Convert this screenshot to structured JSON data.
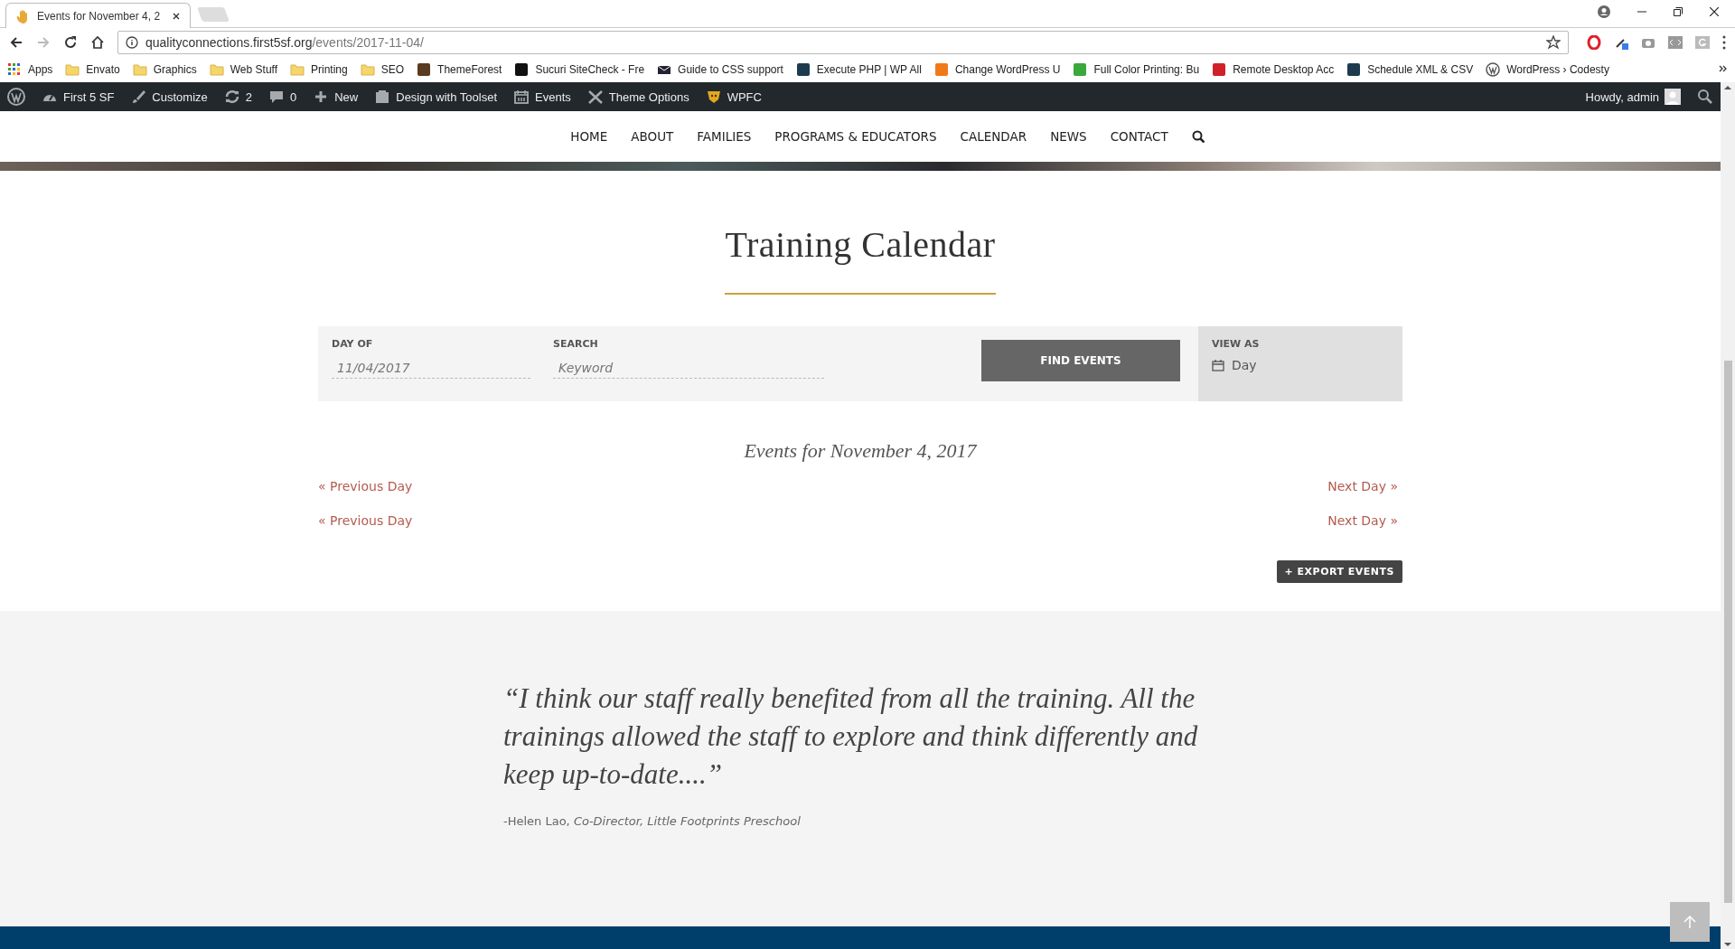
{
  "browser": {
    "tab": {
      "title": "Events for November 4, 2"
    },
    "address": {
      "host": "qualityconnections.first5sf.org",
      "path": "/events/2017-11-04/"
    },
    "bookmarks": [
      {
        "label": "Apps",
        "kind": "apps"
      },
      {
        "label": "Envato",
        "kind": "folder"
      },
      {
        "label": "Graphics",
        "kind": "folder"
      },
      {
        "label": "Web Stuff",
        "kind": "folder"
      },
      {
        "label": "Printing",
        "kind": "folder"
      },
      {
        "label": "SEO",
        "kind": "folder"
      },
      {
        "label": "ThemeForest",
        "kind": "site",
        "color": "#5a3b1e"
      },
      {
        "label": "Sucuri SiteCheck - Fre",
        "kind": "site",
        "color": "#111111"
      },
      {
        "label": "Guide to CSS support",
        "kind": "mail"
      },
      {
        "label": "Execute PHP | WP All",
        "kind": "site",
        "color": "#1d3b4f"
      },
      {
        "label": "Change WordPress U",
        "kind": "site",
        "color": "#f07a18"
      },
      {
        "label": "Full Color Printing: Bu",
        "kind": "site",
        "color": "#3aa83a"
      },
      {
        "label": "Remote Desktop Acc",
        "kind": "site",
        "color": "#d0202a"
      },
      {
        "label": "Schedule XML & CSV",
        "kind": "site",
        "color": "#1d3b4f"
      },
      {
        "label": "WordPress › Codesty",
        "kind": "wp"
      }
    ]
  },
  "admin_bar": {
    "items": [
      {
        "label": "First 5 SF",
        "kind": "dashboard"
      },
      {
        "label": "Customize",
        "kind": "brush"
      },
      {
        "label": "2",
        "kind": "updates"
      },
      {
        "label": "0",
        "kind": "comments"
      },
      {
        "label": "New",
        "kind": "plus"
      },
      {
        "label": "Design with Toolset",
        "kind": "toolset"
      },
      {
        "label": "Events",
        "kind": "calendar"
      },
      {
        "label": "Theme Options",
        "kind": "tools"
      },
      {
        "label": "WPFC",
        "kind": "shield"
      }
    ],
    "greeting": "Howdy, admin"
  },
  "nav": {
    "items": [
      "HOME",
      "ABOUT",
      "FAMILIES",
      "PROGRAMS & EDUCATORS",
      "CALENDAR",
      "NEWS",
      "CONTACT"
    ]
  },
  "calendar": {
    "title": "Training Calendar",
    "filter": {
      "day_label": "DAY OF",
      "day_value": "11/04/2017",
      "search_label": "SEARCH",
      "search_placeholder": "Keyword",
      "button": "FIND EVENTS",
      "view_label": "VIEW AS",
      "view_value": "Day"
    },
    "heading": "Events for November 4, 2017",
    "pagers": [
      {
        "prev": "« Previous Day",
        "next": "Next Day »"
      },
      {
        "prev": "« Previous Day",
        "next": "Next Day »"
      }
    ],
    "export": "+ EXPORT EVENTS"
  },
  "testimonial": {
    "quote": "“I think our staff really benefited from all the training. All the trainings allowed the staff to explore and think differently and keep up-to-date....”",
    "author": "-Helen Lao, *Co-Director, Little Footprints Preschool*"
  }
}
